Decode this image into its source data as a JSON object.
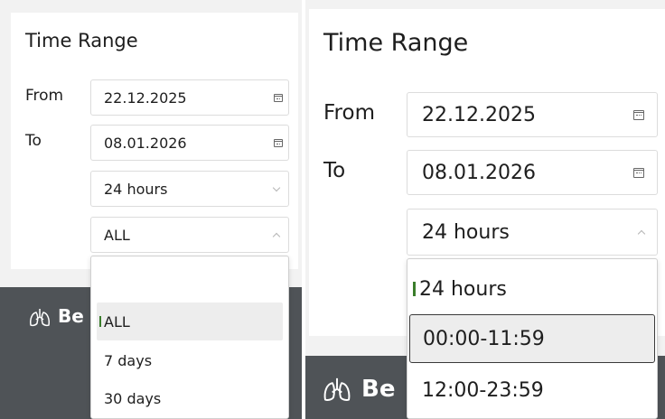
{
  "panel_left": {
    "title": "Time Range",
    "from_label": "From",
    "to_label": "To",
    "from_value": "22.12.2025",
    "to_value": "08.01.2026",
    "duration_value": "24 hours",
    "period_value": "ALL",
    "period_options": [
      "ALL",
      "7 days",
      "30 days"
    ],
    "brand_text": "Be"
  },
  "panel_right": {
    "title": "Time Range",
    "from_label": "From",
    "to_label": "To",
    "from_value": "22.12.2025",
    "to_value": "08.01.2026",
    "duration_value": "24 hours",
    "duration_options": [
      "24 hours",
      "00:00-11:59",
      "12:00-23:59"
    ],
    "brand_text": "Be"
  },
  "icons": {
    "calendar": "calendar-icon",
    "dropdown": "chevron-down-icon",
    "dropup": "chevron-up-icon",
    "lungs": "lungs-icon"
  },
  "colors": {
    "dark_band": "#4f5357",
    "selection_bar": "#3a7d2b",
    "highlight": "#ededed"
  }
}
